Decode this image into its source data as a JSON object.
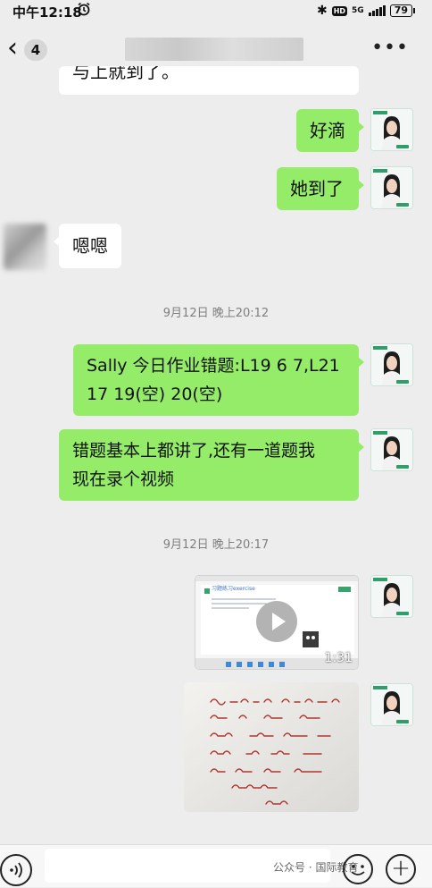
{
  "status_bar": {
    "time": "中午12:18",
    "network": "5G",
    "battery": "79"
  },
  "nav": {
    "unread_count": "4"
  },
  "messages": {
    "m0_text": "与上就到了。",
    "m1_text": "好滴",
    "m2_text": "她到了",
    "m3_text": "嗯嗯",
    "ts1": "9月12日 晚上20:12",
    "m4_line1": "Sally 今日作业错题:L19 6 7,L21",
    "m4_line2": "17 19(空) 20(空)",
    "m5_line1": "错题基本上都讲了,还有一道题我",
    "m5_line2": "现在录个视频",
    "ts2": "9月12日 晚上20:17",
    "video_duration": "1:31",
    "video_heading": "习题练习exercise"
  },
  "input_bar": {
    "watermark": "公众号 · 国际教育"
  },
  "colors": {
    "sent_bubble": "#95ec69",
    "received_bubble": "#ffffff",
    "background": "#ededed"
  },
  "icons": [
    "alarm-icon",
    "bluetooth-icon",
    "signal-icon",
    "battery-icon",
    "back-chevron-icon",
    "more-icon",
    "play-icon",
    "voice-icon",
    "emoji-icon",
    "plus-icon"
  ]
}
